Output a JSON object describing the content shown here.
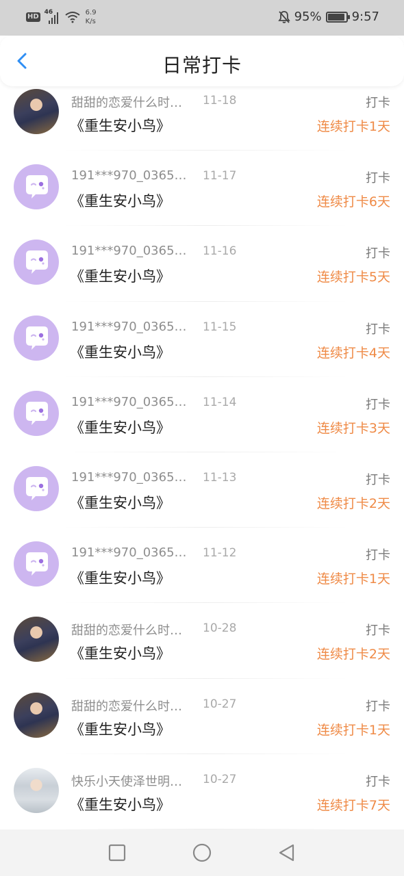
{
  "status_bar": {
    "hd": "HD",
    "network": "46",
    "speed_value": "6.9",
    "speed_unit": "K/s",
    "battery_percent": "95%",
    "battery_level": 0.95,
    "time": "9:57"
  },
  "header": {
    "title": "日常打卡",
    "back_icon": "chevron-left-icon",
    "accent_color": "#2f8ef4"
  },
  "rows": [
    {
      "avatar": "photo-a",
      "name": "甜甜的恋爱什么时…",
      "date": "11-18",
      "action": "打卡",
      "book": "《重生安小鸟》",
      "streak": "连续打卡1天"
    },
    {
      "avatar": "purple",
      "name": "191***970_03653…",
      "date": "11-17",
      "action": "打卡",
      "book": "《重生安小鸟》",
      "streak": "连续打卡6天"
    },
    {
      "avatar": "purple",
      "name": "191***970_03653…",
      "date": "11-16",
      "action": "打卡",
      "book": "《重生安小鸟》",
      "streak": "连续打卡5天"
    },
    {
      "avatar": "purple",
      "name": "191***970_03653…",
      "date": "11-15",
      "action": "打卡",
      "book": "《重生安小鸟》",
      "streak": "连续打卡4天"
    },
    {
      "avatar": "purple",
      "name": "191***970_03653…",
      "date": "11-14",
      "action": "打卡",
      "book": "《重生安小鸟》",
      "streak": "连续打卡3天"
    },
    {
      "avatar": "purple",
      "name": "191***970_03653…",
      "date": "11-13",
      "action": "打卡",
      "book": "《重生安小鸟》",
      "streak": "连续打卡2天"
    },
    {
      "avatar": "purple",
      "name": "191***970_03653…",
      "date": "11-12",
      "action": "打卡",
      "book": "《重生安小鸟》",
      "streak": "连续打卡1天"
    },
    {
      "avatar": "photo-a",
      "name": "甜甜的恋爱什么时…",
      "date": "10-28",
      "action": "打卡",
      "book": "《重生安小鸟》",
      "streak": "连续打卡2天"
    },
    {
      "avatar": "photo-a",
      "name": "甜甜的恋爱什么时…",
      "date": "10-27",
      "action": "打卡",
      "book": "《重生安小鸟》",
      "streak": "连续打卡1天"
    },
    {
      "avatar": "photo-b",
      "name": "快乐小天使泽世明…",
      "date": "10-27",
      "action": "打卡",
      "book": "《重生安小鸟》",
      "streak": "连续打卡7天"
    }
  ],
  "colors": {
    "streak": "#ef8a46",
    "avatar_purple": "#cdb6f0"
  },
  "nav": {
    "icons": [
      "recent-apps-icon",
      "home-icon",
      "back-icon"
    ]
  }
}
